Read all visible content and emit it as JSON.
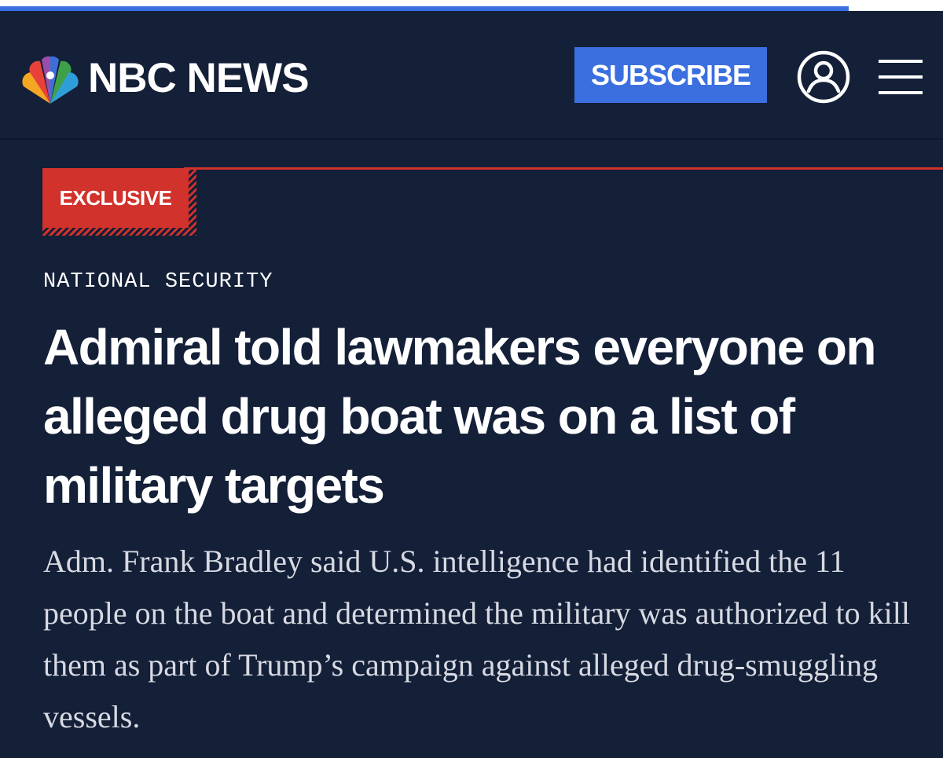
{
  "progress": {
    "fraction": 0.9,
    "color": "#3b6fe0"
  },
  "header": {
    "logo_icon": "nbc-peacock-logo",
    "brand": "NBC NEWS",
    "subscribe_label": "SUBSCRIBE",
    "account_icon": "user-account-icon",
    "menu_icon": "hamburger-menu-icon"
  },
  "article": {
    "badge": "EXCLUSIVE",
    "section": "NATIONAL SECURITY",
    "headline": "Admiral told lawmakers everyone on alleged drug boat was on a list of military targets",
    "dek": "Adm. Frank Bradley said U.S. intelligence had identified the 11 people on the boat and determined the military was authorized to kill them as part of Trump’s campaign against alleged drug-smuggling vessels."
  },
  "colors": {
    "background": "#141f38",
    "accent_blue": "#3b6fe0",
    "accent_red": "#d1322b",
    "text": "#ffffff"
  }
}
